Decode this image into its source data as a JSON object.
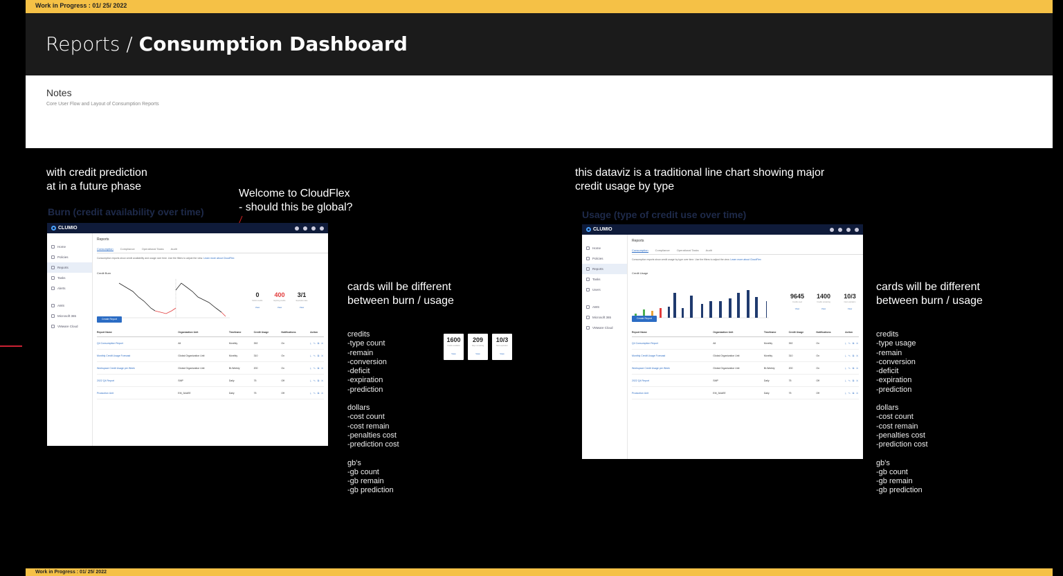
{
  "banner": {
    "top": "Work in Progress : 01/ 25/ 2022",
    "bottom": "Work in Progress : 01/ 25/ 2022"
  },
  "header": {
    "breadcrumb": "Reports /",
    "title": "Consumption Dashboard"
  },
  "notes": {
    "title": "Notes",
    "subtitle": "Core User Flow and Layout of Consumption Reports"
  },
  "left": {
    "note1_line1": "with credit prediction",
    "note1_line2": "at in a future phase",
    "welcome_line1": "Welcome to CloudFlex",
    "welcome_line2": "- should this be global?",
    "section_title": "Burn  (credit availability over time)",
    "cards_note_line1": "cards will be different",
    "cards_note_line2": "between burn / usage",
    "credits": [
      "credits",
      "-type count",
      "-remain",
      "-conversion",
      "-deficit",
      "-expiration",
      "-prediction"
    ],
    "dollars": [
      "dollars",
      "-cost count",
      "-cost remain",
      "-penalties cost",
      "-prediction cost"
    ],
    "gbs": [
      "gb's",
      "-gb count",
      "-gb remain",
      "-gb prediction"
    ],
    "mini_cards": [
      {
        "value": "1600",
        "label": "Credits available",
        "link": "View"
      },
      {
        "value": "209",
        "label": "Days remaining",
        "link": "View"
      },
      {
        "value": "10/3",
        "label": "Next expiration",
        "link": "View"
      }
    ]
  },
  "right": {
    "note1_line1": "this dataviz is a traditional line chart showing major",
    "note1_line2": "credit usage by type",
    "section_title": "Usage (type of credit use over time)",
    "cards_note_line1": "cards will be different",
    "cards_note_line2": "between burn / usage",
    "credits": [
      "credits",
      "-type usage",
      "-remain",
      "-conversion",
      "-deficit",
      "-expiration",
      "-prediction"
    ],
    "dollars": [
      "dollars",
      "-cost count",
      "-cost remain",
      "-penalties cost",
      "-prediction cost"
    ],
    "gbs": [
      "gb's",
      "-gb count",
      "-gb remain",
      "-gb prediction"
    ]
  },
  "mock_left": {
    "brand": "CLUMIO",
    "sidebar": [
      "Home",
      "Policies",
      "Reports",
      "Tasks",
      "Alerts",
      "AWS",
      "Microsoft 365",
      "VMware Cloud"
    ],
    "page_title": "Reports",
    "tabs": [
      "Consumption",
      "Compliance",
      "Operational Tasks",
      "Audit"
    ],
    "desc": "Consumption reports show credit availability and usage over time. Use the filters to adjust the view.",
    "desc_link": "Learn more about CloudFlex",
    "chart_label": "Credit Burn",
    "cards": [
      {
        "value": "0",
        "label": "Deficit credits",
        "link": "View"
      },
      {
        "value": "400",
        "label": "Expiring credits",
        "link": "View"
      },
      {
        "value": "3/1",
        "label": "Expiration date",
        "link": "View"
      }
    ],
    "button": "Create Report",
    "columns": [
      "Report Name",
      "Organization Unit",
      "Timeframe",
      "Credit Usage",
      "Notifications",
      "Action"
    ],
    "rows": [
      [
        "Q4 Consumption Report",
        "All",
        "Monthly",
        "392",
        "On",
        "⤓ ✎ ⧉ ✕"
      ],
      [
        "Monthly Credit Usage Forecast",
        "Global Organization Unit",
        "Monthly",
        "310",
        "On",
        "⤓ ✎ ⧉ ✕"
      ],
      [
        "Workspace Credit Usage per Week",
        "Global Organization Unit",
        "Bi-Weekly",
        "200",
        "On",
        "⤓ ✎ ⧉ ✕"
      ],
      [
        "2022 Q4 Report",
        "SMP",
        "Daily",
        "75",
        "Off",
        "⤓ ✎ ⧉ ✕"
      ],
      [
        "Production Unit",
        "EM_3AAEE",
        "Daily",
        "75",
        "Off",
        "⤓ ✎ ⧉ ✕"
      ]
    ]
  },
  "mock_right": {
    "brand": "CLUMIO",
    "sidebar": [
      "Home",
      "Policies",
      "Reports",
      "Tasks",
      "Users",
      "AWS",
      "Microsoft 365",
      "VMware Cloud"
    ],
    "page_title": "Reports",
    "tabs": [
      "Consumption",
      "Compliance",
      "Operational Tasks",
      "Audit"
    ],
    "desc": "Consumption reports show credit usage by type over time. Use the filters to adjust the view.",
    "desc_link": "Learn more about CloudFlex",
    "chart_label": "Credit Usage",
    "cards": [
      {
        "value": "9645",
        "label": "Credits used",
        "link": "View"
      },
      {
        "value": "1400",
        "label": "Credits remaining",
        "link": "View"
      },
      {
        "value": "10/3",
        "label": "Next expiration",
        "link": "View"
      }
    ],
    "button": "Create Report",
    "columns": [
      "Report Name",
      "Organization Unit",
      "Timeframe",
      "Credit Usage",
      "Notifications",
      "Action"
    ],
    "rows": [
      [
        "Q4 Consumption Report",
        "All",
        "Monthly",
        "392",
        "On",
        "⤓ ✎ ⧉ ✕"
      ],
      [
        "Monthly Credit Usage Forecast",
        "Global Organization Unit",
        "Monthly",
        "310",
        "On",
        "⤓ ✎ ⧉ ✕"
      ],
      [
        "Workspace Credit Usage per Week",
        "Global Organization Unit",
        "Bi-Weekly",
        "200",
        "On",
        "⤓ ✎ ⧉ ✕"
      ],
      [
        "2022 Q4 Report",
        "SMP",
        "Daily",
        "75",
        "Off",
        "⤓ ✎ ⧉ ✕"
      ],
      [
        "Production Unit",
        "EM_3AAEE",
        "Daily",
        "75",
        "Off",
        "⤓ ✎ ⧉ ✕"
      ]
    ]
  },
  "colors": {
    "banner": "#f5c146",
    "header_bg": "#1b1b1b",
    "accent": "#2b6cc4",
    "deficit": "#e23b3b",
    "nav": "#0f1b3a"
  }
}
